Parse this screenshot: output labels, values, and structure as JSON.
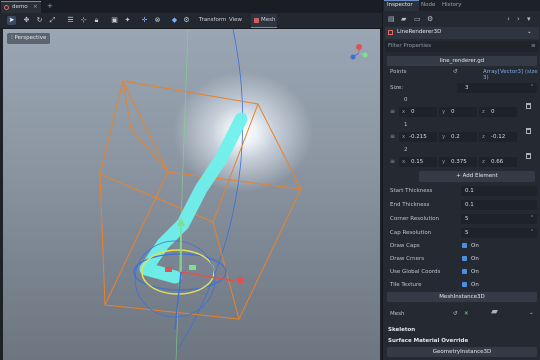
{
  "scene_tab": {
    "label": "demo",
    "close": "×"
  },
  "add_tab": "+",
  "toolbar": {
    "transform": "Transform",
    "view": "View",
    "mesh": "Mesh"
  },
  "viewport": {
    "perspective_label": "⁝ Perspective"
  },
  "dock": {
    "tabs": [
      "Inspector",
      "Node",
      "History"
    ]
  },
  "inspector": {
    "node_name": "LineRenderer3D",
    "filter_placeholder": "Filter Properties",
    "script_section": "line_renderer.gd",
    "points_label": "Points",
    "points_value": "Array[Vector3] (size 3)",
    "size_label": "Size:",
    "size_value": "3",
    "points": [
      {
        "index": "0",
        "x": "0",
        "y": "0",
        "z": "0"
      },
      {
        "index": "1",
        "x": "-0.215",
        "y": "0.2",
        "z": "-0.12"
      },
      {
        "index": "2",
        "x": "0.15",
        "y": "0.375",
        "z": "0.66"
      }
    ],
    "add_element": "+ Add Element",
    "start_thickness_label": "Start Thickness",
    "start_thickness": "0.1",
    "end_thickness_label": "End Thickness",
    "end_thickness": "0.1",
    "corner_res_label": "Corner Resolution",
    "corner_res": "5",
    "cap_res_label": "Cap Resolution",
    "cap_res": "5",
    "draw_caps_label": "Draw Caps",
    "draw_caps": "On",
    "draw_corners_label": "Draw Crners",
    "draw_corners": "On",
    "global_coords_label": "Use Global Coords",
    "global_coords": "On",
    "tile_texture_label": "Tile Texture",
    "tile_texture": "On",
    "meshinstance_section": "MeshInstance3D",
    "mesh_label": "Mesh",
    "skeleton_label": "Skeleton",
    "surface_override_label": "Surface Material Override",
    "geometry_section": "GeometryInstance3D"
  },
  "colors": {
    "accent": "#6c8dc4",
    "checkbox": "#4b8fe0",
    "bbox": "#e8822a",
    "line": "#6ff0ec"
  }
}
